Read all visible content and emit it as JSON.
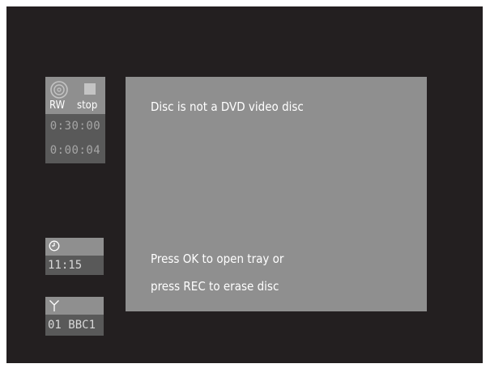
{
  "status": {
    "disc_icon": "disc-icon",
    "stop_icon": "stop-square-icon",
    "mode": "RW",
    "state": "stop",
    "total_time": "0:30:00",
    "elapsed_time": "0:00:04"
  },
  "clock": {
    "icon": "clock-icon",
    "time": "11:15"
  },
  "channel": {
    "icon": "antenna-icon",
    "name": "01 BBC1"
  },
  "dialog": {
    "title": "Disc is not a DVD video disc",
    "instruction_line1": "Press OK to open tray or",
    "instruction_line2": "press REC to erase disc"
  },
  "colors": {
    "background": "#231f20",
    "panel_light": "#8f8f8f",
    "panel_dark": "#595959",
    "text": "#ffffff"
  }
}
